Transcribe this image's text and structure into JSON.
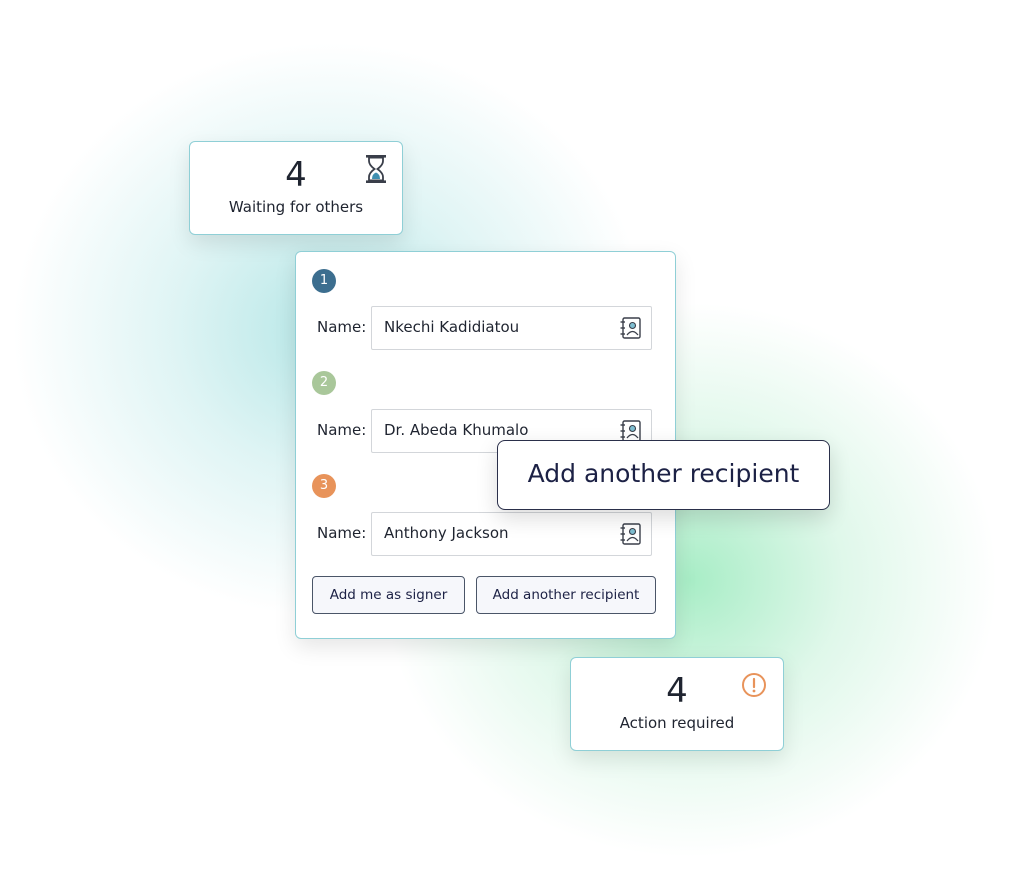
{
  "waiting_card": {
    "count": "4",
    "label": "Waiting for others",
    "icon": "hourglass-icon"
  },
  "recipients": [
    {
      "step": "1",
      "label": "Name:",
      "name": "Nkechi Kadidiatou",
      "badge_color": "#3c6e8f"
    },
    {
      "step": "2",
      "label": "Name:",
      "name": "Dr. Abeda Khumalo",
      "badge_color": "#a9c79a"
    },
    {
      "step": "3",
      "label": "Name:",
      "name": "Anthony Jackson",
      "badge_color": "#e8935a"
    }
  ],
  "buttons": {
    "add_me": "Add me as signer",
    "add_recipient": "Add another recipient"
  },
  "callout": {
    "text": "Add another recipient"
  },
  "action_card": {
    "count": "4",
    "label": "Action required",
    "icon": "alert-icon",
    "icon_color": "#e8935a"
  },
  "colors": {
    "card_border": "#8fcfd6",
    "button_text": "#1c2145"
  }
}
